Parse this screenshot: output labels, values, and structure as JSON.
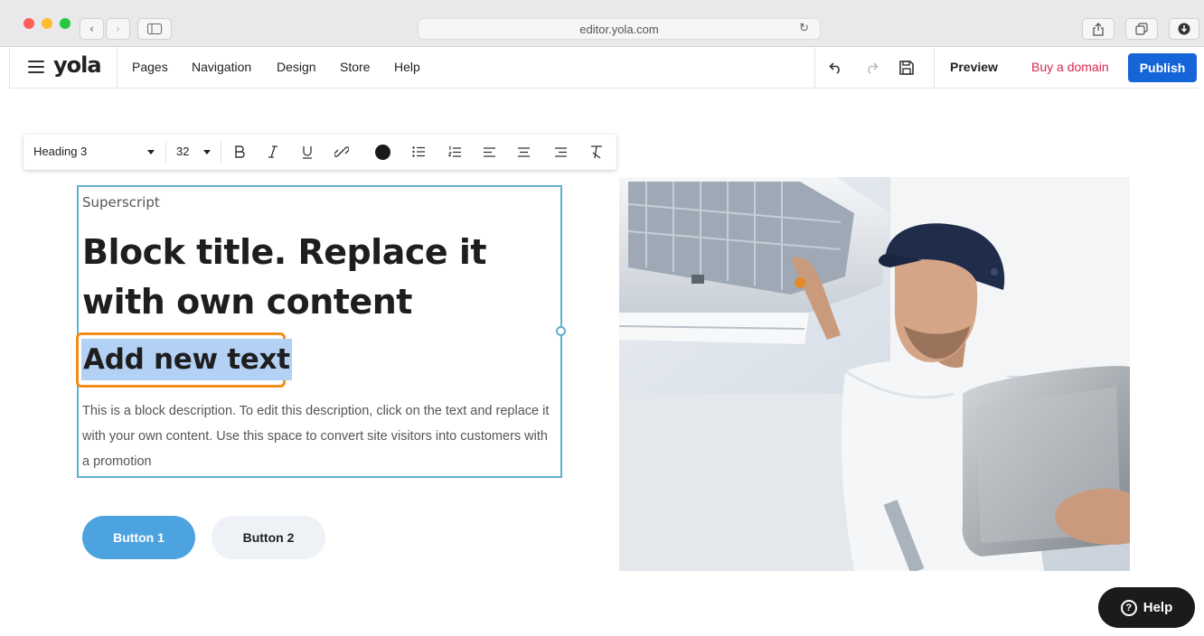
{
  "browser": {
    "url": "editor.yola.com",
    "traffic_colors": [
      "#fe5f57",
      "#febc2e",
      "#28c840"
    ]
  },
  "header": {
    "logo": "yola",
    "nav": [
      "Pages",
      "Navigation",
      "Design",
      "Store",
      "Help"
    ],
    "preview_label": "Preview",
    "buy_domain_label": "Buy a domain",
    "publish_label": "Publish",
    "accent_color": "#1565d8",
    "buy_color": "#d8274f"
  },
  "toolbar": {
    "text_style": "Heading 3",
    "font_size": "32",
    "text_color": "#1a1a1a",
    "icons": [
      "bold-icon",
      "italic-icon",
      "underline-icon",
      "link-icon",
      "text-color-icon",
      "bulleted-list-icon",
      "numbered-list-icon",
      "align-left-icon",
      "align-center-icon",
      "align-right-icon",
      "clear-format-icon"
    ]
  },
  "block": {
    "superscript": "Superscript",
    "title": "Block title. Replace it with own content",
    "selected_text": "Add new text",
    "description": "This is a block description. To edit this description, click on the text and replace it with your own content. Use this space to convert site visitors into customers with a promotion",
    "button1": "Button 1",
    "button2": "Button 2",
    "button1_color": "#4da3e0"
  },
  "help_label": "Help"
}
